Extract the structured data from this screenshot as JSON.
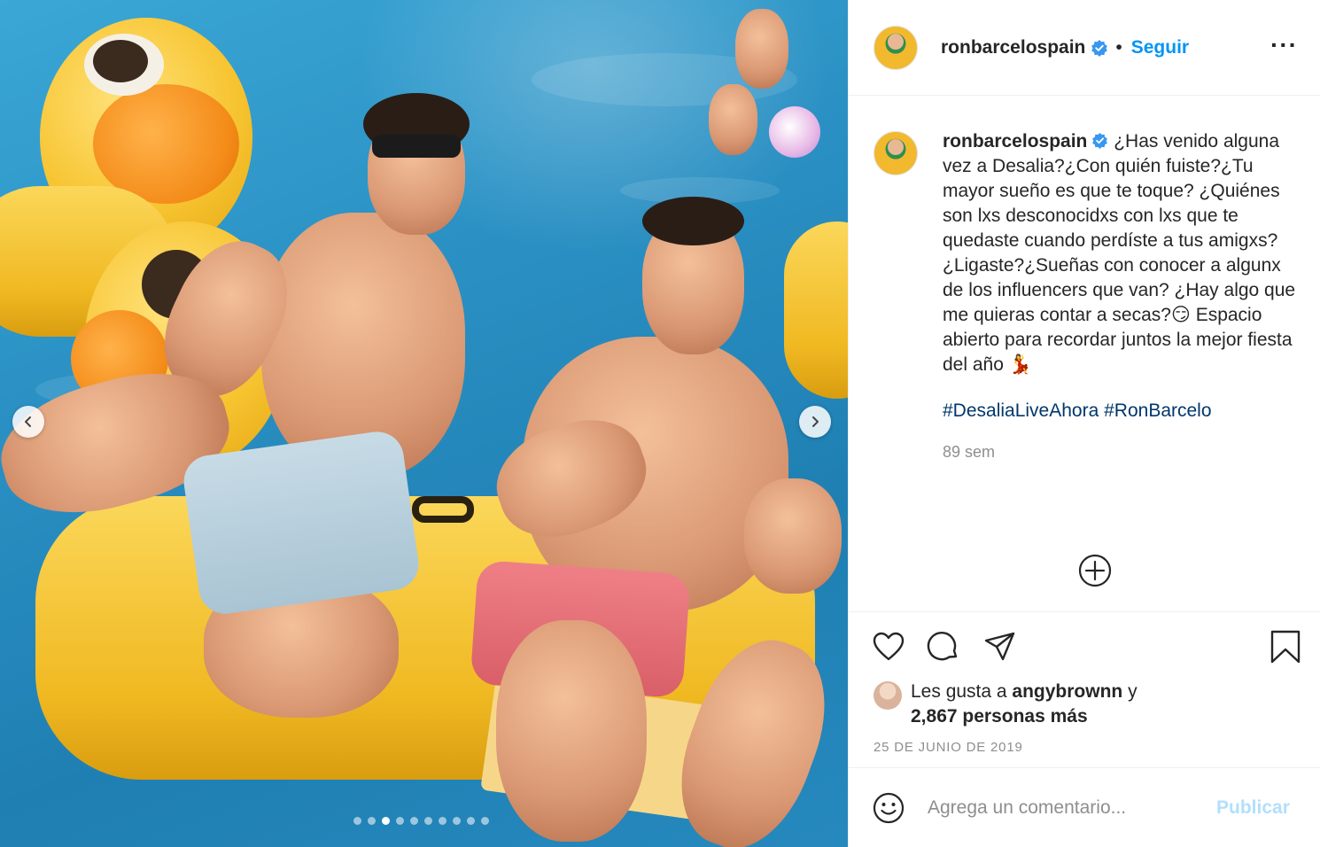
{
  "post": {
    "username": "ronbarcelospain",
    "follow_label": "Seguir",
    "separator": "•",
    "more_label": "···",
    "caption_username": "ronbarcelospain",
    "caption_text": " ¿Has venido alguna vez a Desalia?¿Con quién fuiste?¿Tu mayor sueño es que te toque? ¿Quiénes son lxs desconocidxs con lxs que te quedaste cuando perdíste a tus amigxs? ¿Ligaste?¿Sueñas con conocer a algunx de los influencers que van? ¿Hay algo que me quieras contar a secas?😏 Espacio abierto para recordar juntos la mejor fiesta del año 💃",
    "hashtags": [
      "#DesaliaLiveAhora",
      "#RonBarcelo"
    ],
    "time_ago": "89 sem",
    "likes_prefix": "Les gusta a ",
    "likes_user": "angybrownn",
    "likes_mid": " y",
    "likes_count": "2,867 personas más",
    "date": "25 DE JUNIO DE 2019",
    "comment_placeholder": "Agrega un comentario...",
    "publish_label": "Publicar"
  },
  "carousel": {
    "total": 10,
    "active_index": 2
  },
  "colors": {
    "accent": "#0095f6",
    "publish_disabled": "#b2dffc",
    "hashtag": "#00376b",
    "muted": "#8e8e8e"
  },
  "icons": [
    "verified-badge-icon",
    "more-options-icon",
    "chevron-left-icon",
    "chevron-right-icon",
    "load-more-icon",
    "heart-icon",
    "comment-icon",
    "share-icon",
    "bookmark-icon",
    "emoji-icon"
  ]
}
